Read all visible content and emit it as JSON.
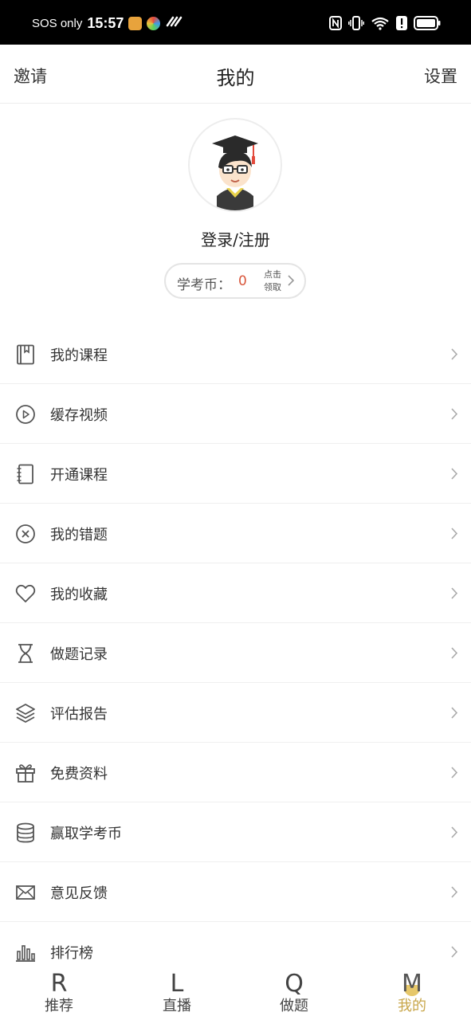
{
  "status_bar": {
    "carrier": "SOS only",
    "time": "15:57"
  },
  "header": {
    "left": "邀请",
    "title": "我的",
    "right": "设置"
  },
  "profile": {
    "login": "登录/注册",
    "coin_label": "学考币：",
    "coin_value": "0",
    "claim_line1": "点击",
    "claim_line2": "领取"
  },
  "menu": [
    {
      "label": "我的课程",
      "icon": "book-icon"
    },
    {
      "label": "缓存视频",
      "icon": "play-circle-icon"
    },
    {
      "label": "开通课程",
      "icon": "notebook-icon"
    },
    {
      "label": "我的错题",
      "icon": "x-circle-icon"
    },
    {
      "label": "我的收藏",
      "icon": "heart-icon"
    },
    {
      "label": "做题记录",
      "icon": "hourglass-icon"
    },
    {
      "label": "评估报告",
      "icon": "layers-icon"
    },
    {
      "label": "免费资料",
      "icon": "gift-icon"
    },
    {
      "label": "赢取学考币",
      "icon": "database-icon"
    },
    {
      "label": "意见反馈",
      "icon": "mail-icon"
    },
    {
      "label": "排行榜",
      "icon": "bar-chart-icon"
    }
  ],
  "tabs": [
    {
      "glyph": "R",
      "label": "推荐"
    },
    {
      "glyph": "L",
      "label": "直播"
    },
    {
      "glyph": "Q",
      "label": "做题"
    },
    {
      "glyph": "M",
      "label": "我的"
    }
  ],
  "colors": {
    "accent": "#c8a64a",
    "coin": "#d9573c"
  }
}
